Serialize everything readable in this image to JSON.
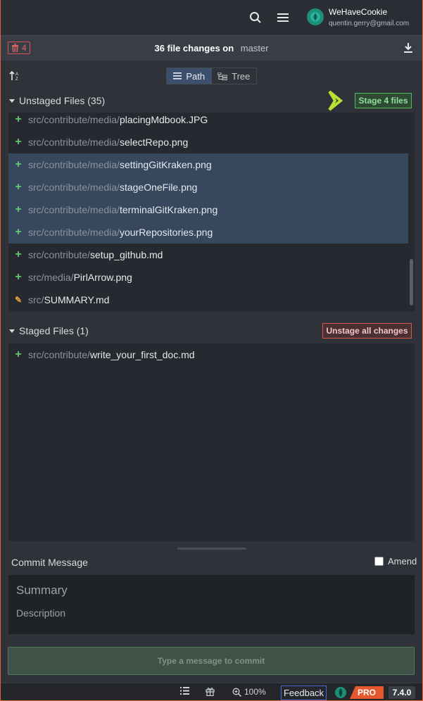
{
  "account": {
    "name": "WeHaveCookie",
    "email": "quentin.gerry@gmail.com"
  },
  "header": {
    "discard_count": "4",
    "file_changes_text": "36 file changes on",
    "branch": "master"
  },
  "view_toggle": {
    "path_label": "Path",
    "tree_label": "Tree"
  },
  "unstaged": {
    "title": "Unstaged Files (35)",
    "stage_button": "Stage 4 files",
    "files": [
      {
        "dir": "src/contribute/media/",
        "name": "placingMdbook.JPG",
        "status": "added",
        "selected": false
      },
      {
        "dir": "src/contribute/media/",
        "name": "selectRepo.png",
        "status": "added",
        "selected": false
      },
      {
        "dir": "src/contribute/media/",
        "name": "settingGitKraken.png",
        "status": "added",
        "selected": true
      },
      {
        "dir": "src/contribute/media/",
        "name": "stageOneFile.png",
        "status": "added",
        "selected": true
      },
      {
        "dir": "src/contribute/media/",
        "name": "terminalGitKraken.png",
        "status": "added",
        "selected": true
      },
      {
        "dir": "src/contribute/media/",
        "name": "yourRepositories.png",
        "status": "added",
        "selected": true
      },
      {
        "dir": "src/contribute/",
        "name": "setup_github.md",
        "status": "added",
        "selected": false
      },
      {
        "dir": "src/media/",
        "name": "PirlArrow.png",
        "status": "added",
        "selected": false
      },
      {
        "dir": "src/",
        "name": "SUMMARY.md",
        "status": "modified",
        "selected": false
      }
    ]
  },
  "staged": {
    "title": "Staged Files (1)",
    "unstage_button": "Unstage all changes",
    "files": [
      {
        "dir": "src/contribute/",
        "name": "write_your_first_doc.md",
        "status": "added"
      }
    ]
  },
  "commit": {
    "label": "Commit Message",
    "amend_label": "Amend",
    "summary_placeholder": "Summary",
    "description_placeholder": "Description",
    "button_label": "Type a message to commit"
  },
  "statusbar": {
    "zoom": "100%",
    "feedback": "Feedback",
    "pro": "PRO",
    "version": "7.4.0"
  },
  "colors": {
    "accent_green": "#4dbe5a",
    "accent_red": "#d9534f",
    "pro_orange": "#e5572c",
    "selection_blue": "#37475e"
  }
}
